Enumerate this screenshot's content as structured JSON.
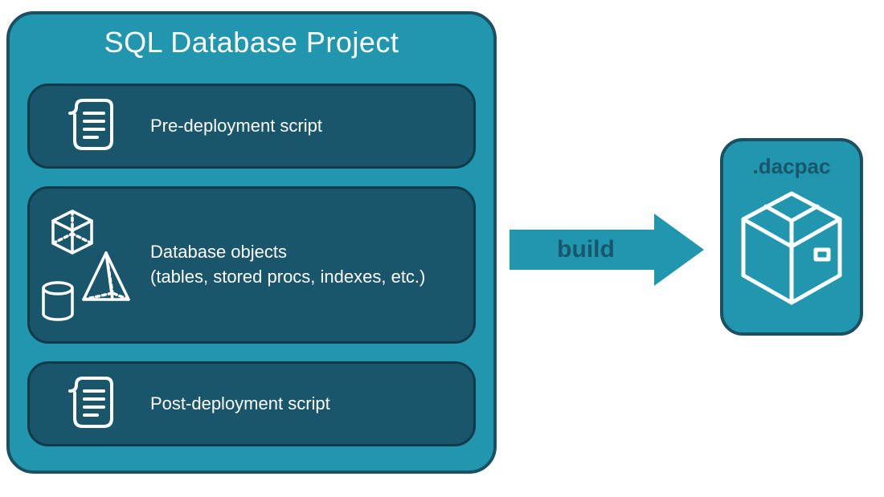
{
  "project": {
    "title": "SQL Database Project",
    "pre_label": "Pre-deployment script",
    "objects_label_line1": "Database objects",
    "objects_label_line2": "(tables, stored procs, indexes, etc.)",
    "post_label": "Post-deployment script"
  },
  "arrow": {
    "label": "build"
  },
  "output": {
    "title": ".dacpac"
  },
  "colors": {
    "teal": "#2097af",
    "dark_teal": "#19566c",
    "border_dark": "#1b5063",
    "white": "#ffffff"
  }
}
